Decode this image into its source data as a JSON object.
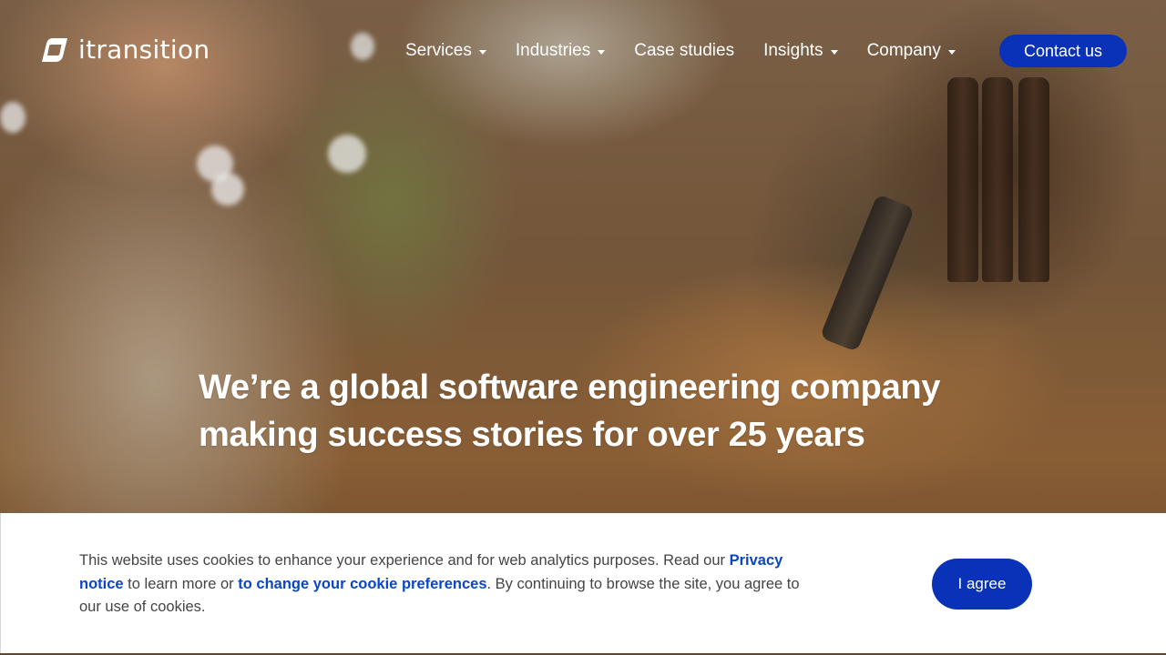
{
  "header": {
    "logo_text": "itransition",
    "logo_icon": "itransition-leaf-logo-icon",
    "nav": [
      {
        "label": "Services",
        "has_dropdown": true
      },
      {
        "label": "Industries",
        "has_dropdown": true
      },
      {
        "label": "Case studies",
        "has_dropdown": false
      },
      {
        "label": "Insights",
        "has_dropdown": true
      },
      {
        "label": "Company",
        "has_dropdown": true
      }
    ],
    "contact_label": "Contact us"
  },
  "hero": {
    "title_line1": "We’re a global software engineering company",
    "title_line2": "making success stories for over 25 years"
  },
  "cookie_banner": {
    "text_part1": "This website uses cookies to enhance your experience and for web analytics purposes. Read our ",
    "privacy_link": "Privacy notice",
    "text_part2": " to learn more or ",
    "preferences_link": "to change your cookie preferences",
    "text_part3": ". By continuing to browse the site, you agree to our use of cookies.",
    "agree_label": "I agree"
  },
  "colors": {
    "brand_blue": "#0a32b8",
    "link_blue": "#0a46c8",
    "text_gray": "#444444"
  }
}
